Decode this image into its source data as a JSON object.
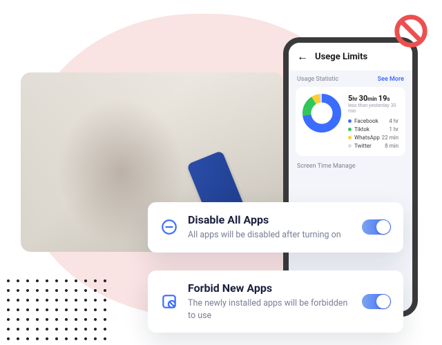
{
  "phone": {
    "title": "Usege Limits",
    "stat_head": "Usage Statistic",
    "see_more": "See More",
    "total_h": "5",
    "total_h_u": "hr ",
    "total_m": "30",
    "total_m_u": "min ",
    "total_s": "19",
    "total_s_u": "s",
    "subline": "less than yesterday 30 min",
    "legend": [
      {
        "name": "Facebook",
        "value": "4 hr",
        "color": "#3a6cff"
      },
      {
        "name": "Tiktok",
        "value": "1 hr",
        "color": "#2fc75a"
      },
      {
        "name": "WhatsApp",
        "value": "22 min",
        "color": "#ffcc33"
      },
      {
        "name": "Twitter",
        "value": "8 min",
        "color": "#d8dbe6"
      }
    ],
    "screen_time": "Screen Time Manage"
  },
  "cards": {
    "disable": {
      "title": "Disable All Apps",
      "desc": "All apps will be disabled after turning on"
    },
    "forbid": {
      "title": "Forbid New Apps",
      "desc": "The newly installed apps will be forbidden to use"
    }
  },
  "chart_data": {
    "type": "pie",
    "title": "Usage Statistic",
    "total_label": "5hr 30min 19s",
    "series": [
      {
        "name": "Facebook",
        "value_minutes": 240,
        "display": "4 hr",
        "color": "#3a6cff"
      },
      {
        "name": "Tiktok",
        "value_minutes": 60,
        "display": "1 hr",
        "color": "#2fc75a"
      },
      {
        "name": "WhatsApp",
        "value_minutes": 22,
        "display": "22 min",
        "color": "#ffcc33"
      },
      {
        "name": "Twitter",
        "value_minutes": 8,
        "display": "8 min",
        "color": "#d8dbe6"
      }
    ]
  }
}
